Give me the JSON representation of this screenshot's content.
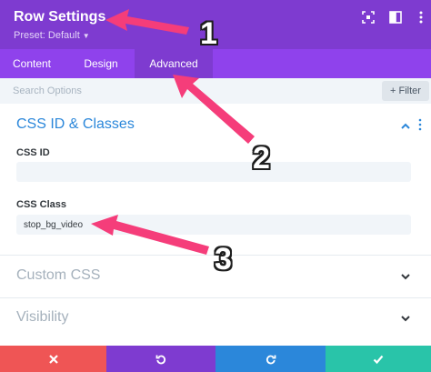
{
  "header": {
    "title": "Row Settings",
    "preset_label": "Preset: Default",
    "icons": [
      "expand-icon",
      "split-view-icon",
      "more-options-icon"
    ],
    "background": "#7e3bd0"
  },
  "tabs": [
    {
      "label": "Content",
      "active": false
    },
    {
      "label": "Design",
      "active": false
    },
    {
      "label": "Advanced",
      "active": true
    }
  ],
  "search": {
    "placeholder": "Search Options",
    "filter_label": "+ Filter"
  },
  "sections": {
    "css_id_classes": {
      "title": "CSS ID & Classes",
      "expanded": true,
      "fields": [
        {
          "label": "CSS ID",
          "value": ""
        },
        {
          "label": "CSS Class",
          "value": "stop_bg_video"
        }
      ]
    },
    "custom_css": {
      "title": "Custom CSS",
      "expanded": false
    },
    "visibility": {
      "title": "Visibility",
      "expanded": false
    }
  },
  "footer": {
    "buttons": [
      {
        "name": "discard",
        "icon": "close-icon",
        "color": "#ef5555"
      },
      {
        "name": "undo",
        "icon": "undo-icon",
        "color": "#7e3bd0"
      },
      {
        "name": "redo",
        "icon": "redo-icon",
        "color": "#2b87da"
      },
      {
        "name": "save",
        "icon": "check-icon",
        "color": "#29c4a9"
      }
    ]
  },
  "annotations": {
    "color": "#f53d7a",
    "labels": [
      "1",
      "2",
      "3"
    ]
  }
}
